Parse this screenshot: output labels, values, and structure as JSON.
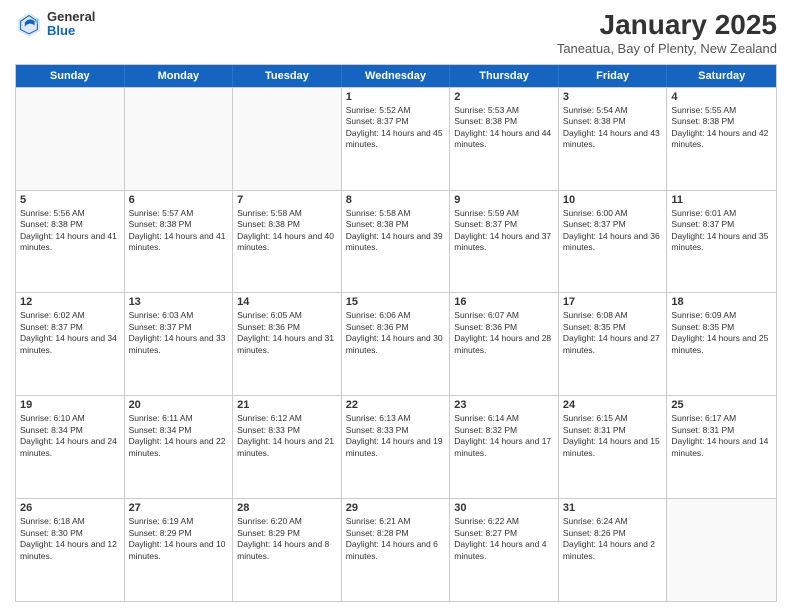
{
  "header": {
    "logo_general": "General",
    "logo_blue": "Blue",
    "month_title": "January 2025",
    "subtitle": "Taneatua, Bay of Plenty, New Zealand"
  },
  "calendar": {
    "days": [
      "Sunday",
      "Monday",
      "Tuesday",
      "Wednesday",
      "Thursday",
      "Friday",
      "Saturday"
    ],
    "rows": [
      [
        {
          "day": "",
          "sunrise": "",
          "sunset": "",
          "daylight": "",
          "empty": true
        },
        {
          "day": "",
          "sunrise": "",
          "sunset": "",
          "daylight": "",
          "empty": true
        },
        {
          "day": "",
          "sunrise": "",
          "sunset": "",
          "daylight": "",
          "empty": true
        },
        {
          "day": "1",
          "sunrise": "Sunrise: 5:52 AM",
          "sunset": "Sunset: 8:37 PM",
          "daylight": "Daylight: 14 hours and 45 minutes."
        },
        {
          "day": "2",
          "sunrise": "Sunrise: 5:53 AM",
          "sunset": "Sunset: 8:38 PM",
          "daylight": "Daylight: 14 hours and 44 minutes."
        },
        {
          "day": "3",
          "sunrise": "Sunrise: 5:54 AM",
          "sunset": "Sunset: 8:38 PM",
          "daylight": "Daylight: 14 hours and 43 minutes."
        },
        {
          "day": "4",
          "sunrise": "Sunrise: 5:55 AM",
          "sunset": "Sunset: 8:38 PM",
          "daylight": "Daylight: 14 hours and 42 minutes."
        }
      ],
      [
        {
          "day": "5",
          "sunrise": "Sunrise: 5:56 AM",
          "sunset": "Sunset: 8:38 PM",
          "daylight": "Daylight: 14 hours and 41 minutes."
        },
        {
          "day": "6",
          "sunrise": "Sunrise: 5:57 AM",
          "sunset": "Sunset: 8:38 PM",
          "daylight": "Daylight: 14 hours and 41 minutes."
        },
        {
          "day": "7",
          "sunrise": "Sunrise: 5:58 AM",
          "sunset": "Sunset: 8:38 PM",
          "daylight": "Daylight: 14 hours and 40 minutes."
        },
        {
          "day": "8",
          "sunrise": "Sunrise: 5:58 AM",
          "sunset": "Sunset: 8:38 PM",
          "daylight": "Daylight: 14 hours and 39 minutes."
        },
        {
          "day": "9",
          "sunrise": "Sunrise: 5:59 AM",
          "sunset": "Sunset: 8:37 PM",
          "daylight": "Daylight: 14 hours and 37 minutes."
        },
        {
          "day": "10",
          "sunrise": "Sunrise: 6:00 AM",
          "sunset": "Sunset: 8:37 PM",
          "daylight": "Daylight: 14 hours and 36 minutes."
        },
        {
          "day": "11",
          "sunrise": "Sunrise: 6:01 AM",
          "sunset": "Sunset: 8:37 PM",
          "daylight": "Daylight: 14 hours and 35 minutes."
        }
      ],
      [
        {
          "day": "12",
          "sunrise": "Sunrise: 6:02 AM",
          "sunset": "Sunset: 8:37 PM",
          "daylight": "Daylight: 14 hours and 34 minutes."
        },
        {
          "day": "13",
          "sunrise": "Sunrise: 6:03 AM",
          "sunset": "Sunset: 8:37 PM",
          "daylight": "Daylight: 14 hours and 33 minutes."
        },
        {
          "day": "14",
          "sunrise": "Sunrise: 6:05 AM",
          "sunset": "Sunset: 8:36 PM",
          "daylight": "Daylight: 14 hours and 31 minutes."
        },
        {
          "day": "15",
          "sunrise": "Sunrise: 6:06 AM",
          "sunset": "Sunset: 8:36 PM",
          "daylight": "Daylight: 14 hours and 30 minutes."
        },
        {
          "day": "16",
          "sunrise": "Sunrise: 6:07 AM",
          "sunset": "Sunset: 8:36 PM",
          "daylight": "Daylight: 14 hours and 28 minutes."
        },
        {
          "day": "17",
          "sunrise": "Sunrise: 6:08 AM",
          "sunset": "Sunset: 8:35 PM",
          "daylight": "Daylight: 14 hours and 27 minutes."
        },
        {
          "day": "18",
          "sunrise": "Sunrise: 6:09 AM",
          "sunset": "Sunset: 8:35 PM",
          "daylight": "Daylight: 14 hours and 25 minutes."
        }
      ],
      [
        {
          "day": "19",
          "sunrise": "Sunrise: 6:10 AM",
          "sunset": "Sunset: 8:34 PM",
          "daylight": "Daylight: 14 hours and 24 minutes."
        },
        {
          "day": "20",
          "sunrise": "Sunrise: 6:11 AM",
          "sunset": "Sunset: 8:34 PM",
          "daylight": "Daylight: 14 hours and 22 minutes."
        },
        {
          "day": "21",
          "sunrise": "Sunrise: 6:12 AM",
          "sunset": "Sunset: 8:33 PM",
          "daylight": "Daylight: 14 hours and 21 minutes."
        },
        {
          "day": "22",
          "sunrise": "Sunrise: 6:13 AM",
          "sunset": "Sunset: 8:33 PM",
          "daylight": "Daylight: 14 hours and 19 minutes."
        },
        {
          "day": "23",
          "sunrise": "Sunrise: 6:14 AM",
          "sunset": "Sunset: 8:32 PM",
          "daylight": "Daylight: 14 hours and 17 minutes."
        },
        {
          "day": "24",
          "sunrise": "Sunrise: 6:15 AM",
          "sunset": "Sunset: 8:31 PM",
          "daylight": "Daylight: 14 hours and 15 minutes."
        },
        {
          "day": "25",
          "sunrise": "Sunrise: 6:17 AM",
          "sunset": "Sunset: 8:31 PM",
          "daylight": "Daylight: 14 hours and 14 minutes."
        }
      ],
      [
        {
          "day": "26",
          "sunrise": "Sunrise: 6:18 AM",
          "sunset": "Sunset: 8:30 PM",
          "daylight": "Daylight: 14 hours and 12 minutes."
        },
        {
          "day": "27",
          "sunrise": "Sunrise: 6:19 AM",
          "sunset": "Sunset: 8:29 PM",
          "daylight": "Daylight: 14 hours and 10 minutes."
        },
        {
          "day": "28",
          "sunrise": "Sunrise: 6:20 AM",
          "sunset": "Sunset: 8:29 PM",
          "daylight": "Daylight: 14 hours and 8 minutes."
        },
        {
          "day": "29",
          "sunrise": "Sunrise: 6:21 AM",
          "sunset": "Sunset: 8:28 PM",
          "daylight": "Daylight: 14 hours and 6 minutes."
        },
        {
          "day": "30",
          "sunrise": "Sunrise: 6:22 AM",
          "sunset": "Sunset: 8:27 PM",
          "daylight": "Daylight: 14 hours and 4 minutes."
        },
        {
          "day": "31",
          "sunrise": "Sunrise: 6:24 AM",
          "sunset": "Sunset: 8:26 PM",
          "daylight": "Daylight: 14 hours and 2 minutes."
        },
        {
          "day": "",
          "sunrise": "",
          "sunset": "",
          "daylight": "",
          "empty": true
        }
      ]
    ]
  }
}
